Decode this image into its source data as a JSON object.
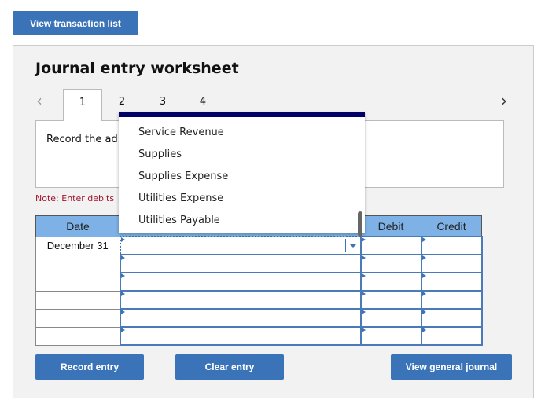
{
  "top_button": "View transaction list",
  "title": "Journal entry worksheet",
  "tabs": [
    "1",
    "2",
    "3",
    "4"
  ],
  "instruction": "Record the ad",
  "note": "Note: Enter debits",
  "table": {
    "headers": [
      "Date",
      "",
      "Debit",
      "Credit"
    ],
    "rows": [
      {
        "date": "December 31"
      },
      {
        "date": ""
      },
      {
        "date": ""
      },
      {
        "date": ""
      },
      {
        "date": ""
      },
      {
        "date": ""
      }
    ]
  },
  "dropdown": {
    "options": [
      "Service Revenue",
      "Supplies",
      "Supplies Expense",
      "Utilities Expense",
      "Utilities Payable"
    ]
  },
  "buttons": {
    "record": "Record entry",
    "clear": "Clear entry",
    "view_journal": "View general journal"
  },
  "colors": {
    "button": "#3a73b8",
    "header": "#7eb2e6",
    "dropdown_bar": "#000066"
  }
}
